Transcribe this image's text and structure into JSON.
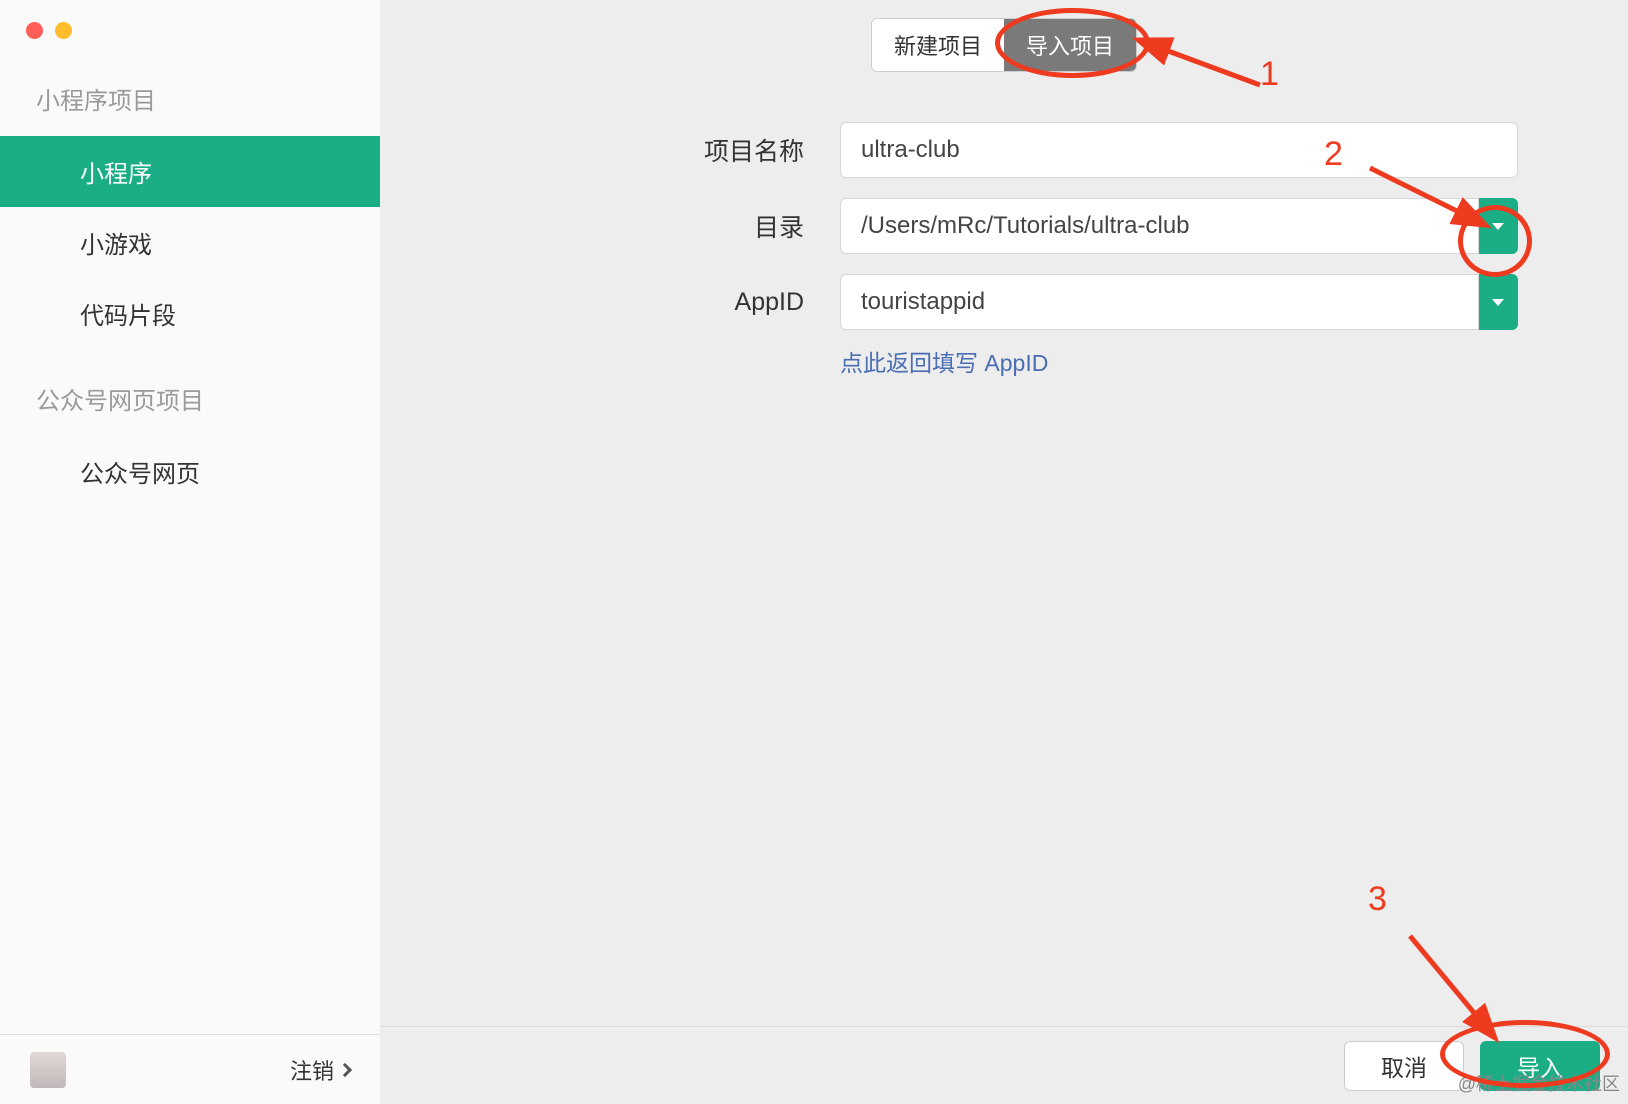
{
  "sidebar": {
    "section1_title": "小程序项目",
    "items1": [
      {
        "label": "小程序",
        "active": true
      },
      {
        "label": "小游戏",
        "active": false
      },
      {
        "label": "代码片段",
        "active": false
      }
    ],
    "section2_title": "公众号网页项目",
    "items2": [
      {
        "label": "公众号网页",
        "active": false
      }
    ],
    "logout_label": "注销"
  },
  "tabs": {
    "new_label": "新建项目",
    "import_label": "导入项目"
  },
  "form": {
    "project_name_label": "项目名称",
    "project_name_value": "ultra-club",
    "directory_label": "目录",
    "directory_value": "/Users/mRc/Tutorials/ultra-club",
    "appid_label": "AppID",
    "appid_value": "touristappid",
    "appid_link": "点此返回填写 AppID"
  },
  "footer": {
    "cancel_label": "取消",
    "import_label": "导入"
  },
  "annotations": {
    "n1": "1",
    "n2": "2",
    "n3": "3"
  },
  "watermark": "@稀土掘金技术社区"
}
